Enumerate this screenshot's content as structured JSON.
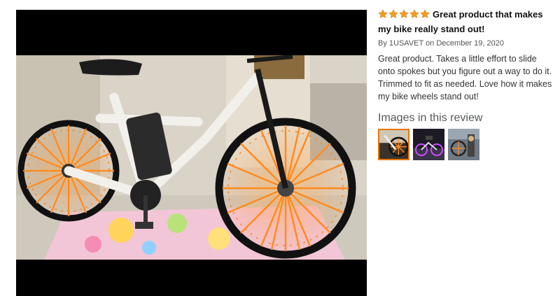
{
  "review": {
    "rating_stars": 5,
    "star_color": "#f79e1b",
    "title": "Great product that makes my bike really stand out!",
    "byline": "By 1USAVET on December 19, 2020",
    "body": "Great product. Takes a little effort to slide onto spokes but you figure out a way to do it. Trimmed to fit as needed. Love how it makes my bike wheels stand out!",
    "images_heading": "Images in this review",
    "thumbnails": [
      {
        "icon": "bike-wheel-photo",
        "selected": true
      },
      {
        "icon": "bike-night-photo",
        "selected": false
      },
      {
        "icon": "bike-rack-photo",
        "selected": false
      }
    ]
  },
  "colors": {
    "accent_orange": "#e77600",
    "spoke_orange": "#ff8a1e",
    "muted_heading": "#565959"
  }
}
